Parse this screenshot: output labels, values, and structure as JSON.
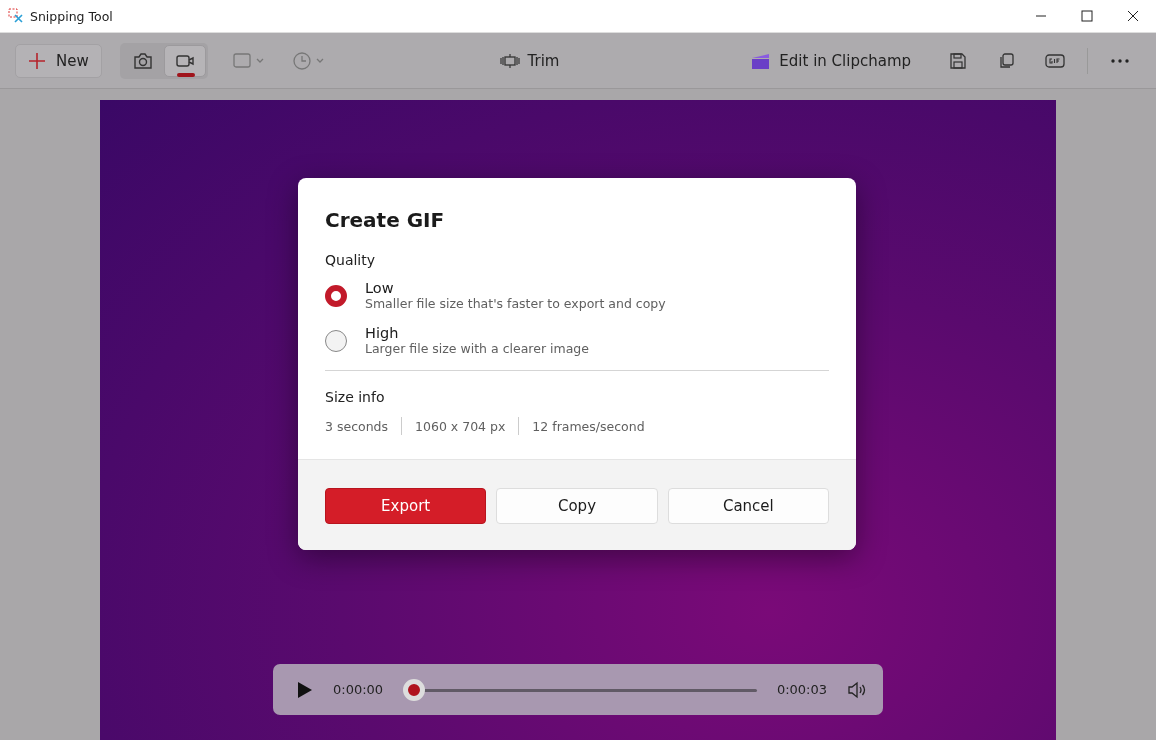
{
  "window": {
    "title": "Snipping Tool"
  },
  "toolbar": {
    "new_label": "New",
    "modes": [
      {
        "kind": "photo",
        "selected": false
      },
      {
        "kind": "video",
        "selected": true
      }
    ],
    "trim_label": "Trim",
    "clipchamp_label": "Edit in Clipchamp"
  },
  "dialog": {
    "title": "Create GIF",
    "quality_label": "Quality",
    "options": [
      {
        "label": "Low",
        "description": "Smaller file size that's faster to export and copy",
        "selected": true
      },
      {
        "label": "High",
        "description": "Larger file size with a clearer image",
        "selected": false
      }
    ],
    "size_info_label": "Size info",
    "size_info": [
      "3 seconds",
      "1060 x 704 px",
      "12 frames/second"
    ],
    "buttons": [
      {
        "label": "Export",
        "kind": "primary"
      },
      {
        "label": "Copy",
        "kind": "secondary"
      },
      {
        "label": "Cancel",
        "kind": "secondary"
      }
    ]
  },
  "player": {
    "current_time": "0:00:00",
    "total_time": "0:00:03",
    "level": 0
  }
}
